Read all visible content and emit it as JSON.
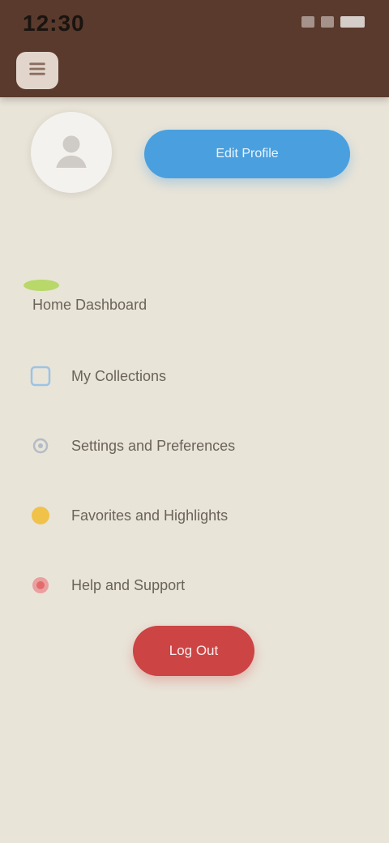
{
  "status_bar": {
    "time": "12:30",
    "icons": [
      "signal-icon",
      "wifi-icon",
      "battery-icon"
    ]
  },
  "header": {
    "menu_icon": "menu-icon",
    "background_color": "#5a3a2c"
  },
  "profile": {
    "avatar_icon": "user-avatar-icon",
    "primary_button_label": "Edit Profile",
    "primary_button_color": "#4aa0df"
  },
  "menu": {
    "items": [
      {
        "label": "Home Dashboard",
        "icon": "leaf-icon",
        "color": "#a9cf54"
      },
      {
        "label": "My Collections",
        "icon": "grid-icon",
        "color": "#7fb4e0"
      },
      {
        "label": "Settings and Preferences",
        "icon": "gear-icon",
        "color": "#9aa7b4"
      },
      {
        "label": "Favorites and Highlights",
        "icon": "star-icon",
        "color": "#f0c040"
      },
      {
        "label": "Help and Support",
        "icon": "help-icon",
        "color": "#e46b6b"
      }
    ]
  },
  "logout": {
    "label": "Log Out",
    "color": "#cc4444"
  }
}
